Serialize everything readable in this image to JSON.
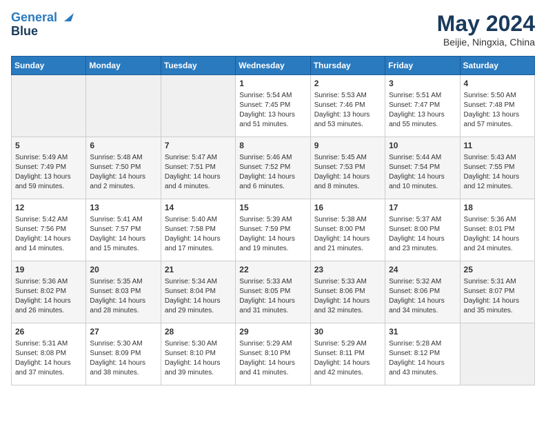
{
  "header": {
    "logo_line1": "General",
    "logo_line2": "Blue",
    "title": "May 2024",
    "location": "Beijie, Ningxia, China"
  },
  "days_of_week": [
    "Sunday",
    "Monday",
    "Tuesday",
    "Wednesday",
    "Thursday",
    "Friday",
    "Saturday"
  ],
  "weeks": [
    [
      {
        "day": "",
        "info": ""
      },
      {
        "day": "",
        "info": ""
      },
      {
        "day": "",
        "info": ""
      },
      {
        "day": "1",
        "info": "Sunrise: 5:54 AM\nSunset: 7:45 PM\nDaylight: 13 hours\nand 51 minutes."
      },
      {
        "day": "2",
        "info": "Sunrise: 5:53 AM\nSunset: 7:46 PM\nDaylight: 13 hours\nand 53 minutes."
      },
      {
        "day": "3",
        "info": "Sunrise: 5:51 AM\nSunset: 7:47 PM\nDaylight: 13 hours\nand 55 minutes."
      },
      {
        "day": "4",
        "info": "Sunrise: 5:50 AM\nSunset: 7:48 PM\nDaylight: 13 hours\nand 57 minutes."
      }
    ],
    [
      {
        "day": "5",
        "info": "Sunrise: 5:49 AM\nSunset: 7:49 PM\nDaylight: 13 hours\nand 59 minutes."
      },
      {
        "day": "6",
        "info": "Sunrise: 5:48 AM\nSunset: 7:50 PM\nDaylight: 14 hours\nand 2 minutes."
      },
      {
        "day": "7",
        "info": "Sunrise: 5:47 AM\nSunset: 7:51 PM\nDaylight: 14 hours\nand 4 minutes."
      },
      {
        "day": "8",
        "info": "Sunrise: 5:46 AM\nSunset: 7:52 PM\nDaylight: 14 hours\nand 6 minutes."
      },
      {
        "day": "9",
        "info": "Sunrise: 5:45 AM\nSunset: 7:53 PM\nDaylight: 14 hours\nand 8 minutes."
      },
      {
        "day": "10",
        "info": "Sunrise: 5:44 AM\nSunset: 7:54 PM\nDaylight: 14 hours\nand 10 minutes."
      },
      {
        "day": "11",
        "info": "Sunrise: 5:43 AM\nSunset: 7:55 PM\nDaylight: 14 hours\nand 12 minutes."
      }
    ],
    [
      {
        "day": "12",
        "info": "Sunrise: 5:42 AM\nSunset: 7:56 PM\nDaylight: 14 hours\nand 14 minutes."
      },
      {
        "day": "13",
        "info": "Sunrise: 5:41 AM\nSunset: 7:57 PM\nDaylight: 14 hours\nand 15 minutes."
      },
      {
        "day": "14",
        "info": "Sunrise: 5:40 AM\nSunset: 7:58 PM\nDaylight: 14 hours\nand 17 minutes."
      },
      {
        "day": "15",
        "info": "Sunrise: 5:39 AM\nSunset: 7:59 PM\nDaylight: 14 hours\nand 19 minutes."
      },
      {
        "day": "16",
        "info": "Sunrise: 5:38 AM\nSunset: 8:00 PM\nDaylight: 14 hours\nand 21 minutes."
      },
      {
        "day": "17",
        "info": "Sunrise: 5:37 AM\nSunset: 8:00 PM\nDaylight: 14 hours\nand 23 minutes."
      },
      {
        "day": "18",
        "info": "Sunrise: 5:36 AM\nSunset: 8:01 PM\nDaylight: 14 hours\nand 24 minutes."
      }
    ],
    [
      {
        "day": "19",
        "info": "Sunrise: 5:36 AM\nSunset: 8:02 PM\nDaylight: 14 hours\nand 26 minutes."
      },
      {
        "day": "20",
        "info": "Sunrise: 5:35 AM\nSunset: 8:03 PM\nDaylight: 14 hours\nand 28 minutes."
      },
      {
        "day": "21",
        "info": "Sunrise: 5:34 AM\nSunset: 8:04 PM\nDaylight: 14 hours\nand 29 minutes."
      },
      {
        "day": "22",
        "info": "Sunrise: 5:33 AM\nSunset: 8:05 PM\nDaylight: 14 hours\nand 31 minutes."
      },
      {
        "day": "23",
        "info": "Sunrise: 5:33 AM\nSunset: 8:06 PM\nDaylight: 14 hours\nand 32 minutes."
      },
      {
        "day": "24",
        "info": "Sunrise: 5:32 AM\nSunset: 8:06 PM\nDaylight: 14 hours\nand 34 minutes."
      },
      {
        "day": "25",
        "info": "Sunrise: 5:31 AM\nSunset: 8:07 PM\nDaylight: 14 hours\nand 35 minutes."
      }
    ],
    [
      {
        "day": "26",
        "info": "Sunrise: 5:31 AM\nSunset: 8:08 PM\nDaylight: 14 hours\nand 37 minutes."
      },
      {
        "day": "27",
        "info": "Sunrise: 5:30 AM\nSunset: 8:09 PM\nDaylight: 14 hours\nand 38 minutes."
      },
      {
        "day": "28",
        "info": "Sunrise: 5:30 AM\nSunset: 8:10 PM\nDaylight: 14 hours\nand 39 minutes."
      },
      {
        "day": "29",
        "info": "Sunrise: 5:29 AM\nSunset: 8:10 PM\nDaylight: 14 hours\nand 41 minutes."
      },
      {
        "day": "30",
        "info": "Sunrise: 5:29 AM\nSunset: 8:11 PM\nDaylight: 14 hours\nand 42 minutes."
      },
      {
        "day": "31",
        "info": "Sunrise: 5:28 AM\nSunset: 8:12 PM\nDaylight: 14 hours\nand 43 minutes."
      },
      {
        "day": "",
        "info": ""
      }
    ]
  ]
}
